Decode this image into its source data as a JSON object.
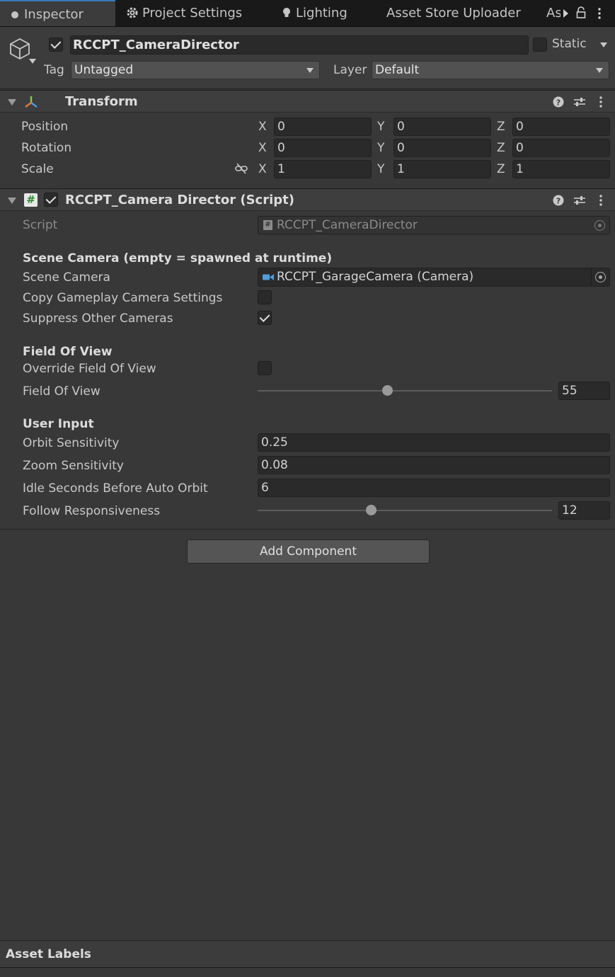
{
  "tabs": [
    {
      "label": "Inspector",
      "icon": "info-icon"
    },
    {
      "label": "Project Settings",
      "icon": "gear-icon"
    },
    {
      "label": "Lighting",
      "icon": "bulb-icon"
    },
    {
      "label": "Asset Store Uploader",
      "icon": ""
    },
    {
      "label": "As",
      "icon": ""
    }
  ],
  "header": {
    "object_name": "RCCPT_CameraDirector",
    "active": true,
    "static_label": "Static",
    "static": false,
    "tag_label": "Tag",
    "tag_value": "Untagged",
    "layer_label": "Layer",
    "layer_value": "Default"
  },
  "transform": {
    "title": "Transform",
    "rows": [
      {
        "label": "Position",
        "x": "0",
        "y": "0",
        "z": "0"
      },
      {
        "label": "Rotation",
        "x": "0",
        "y": "0",
        "z": "0"
      },
      {
        "label": "Scale",
        "x": "1",
        "y": "1",
        "z": "1"
      }
    ],
    "axis_x": "X",
    "axis_y": "Y",
    "axis_z": "Z"
  },
  "director": {
    "title": "RCCPT_Camera Director (Script)",
    "enabled": true,
    "script_label": "Script",
    "script_value": "RCCPT_CameraDirector",
    "section_scene": "Scene Camera (empty = spawned at runtime)",
    "scene_camera_label": "Scene Camera",
    "scene_camera_value": "RCCPT_GarageCamera (Camera)",
    "copy_label": "Copy Gameplay Camera Settings",
    "copy_value": false,
    "suppress_label": "Suppress Other Cameras",
    "suppress_value": true,
    "section_fov": "Field Of View",
    "override_fov_label": "Override Field Of View",
    "override_fov_value": false,
    "fov_label": "Field Of View",
    "fov_value": "55",
    "fov_fraction": 0.44,
    "section_input": "User Input",
    "orbit_label": "Orbit Sensitivity",
    "orbit_value": "0.25",
    "zoom_label": "Zoom Sensitivity",
    "zoom_value": "0.08",
    "idle_label": "Idle Seconds Before Auto Orbit",
    "idle_value": "6",
    "follow_label": "Follow Responsiveness",
    "follow_value": "12",
    "follow_fraction": 0.385
  },
  "add_component_label": "Add Component",
  "asset_labels": "Asset Labels",
  "colors": {
    "accent": "#3a79bb",
    "background": "#383838"
  }
}
